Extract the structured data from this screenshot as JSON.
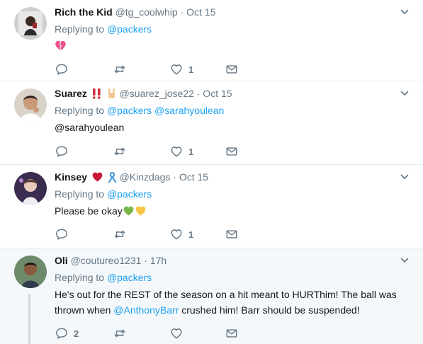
{
  "tweets": [
    {
      "fullname": "Rich the Kid",
      "meta": "@tg_coolwhip · Oct 15",
      "replying_label": "Replying to",
      "replying_to": "@packers",
      "text_emoji": "broken-heart-emoji",
      "reply_count": "",
      "retweet_count": "",
      "like_count": "1"
    },
    {
      "fullname": "Suarez",
      "name_emojis": [
        "double-exclamation-emoji",
        "rock-hand-emoji"
      ],
      "meta": "@suarez_jose22 · Oct 15",
      "replying_label": "Replying to",
      "replying_to": "@packers @sarahyoulean",
      "text": "@sarahyoulean",
      "reply_count": "",
      "retweet_count": "",
      "like_count": "1"
    },
    {
      "fullname": "Kinsey",
      "name_emojis": [
        "red-heart-emoji",
        "awareness-ribbon-emoji"
      ],
      "meta": "@Kinzdags · Oct 15",
      "replying_label": "Replying to",
      "replying_to": "@packers",
      "text": "Please be okay",
      "text_emojis": [
        "green-heart-emoji",
        "yellow-heart-emoji"
      ],
      "reply_count": "",
      "retweet_count": "",
      "like_count": "1"
    },
    {
      "fullname": "Oli",
      "meta": "@coutureo1231 · 17h",
      "replying_label": "Replying to",
      "replying_to": "@packers",
      "text_line1": "He's out for the REST of the season on a hit meant to HURThim! The ball was",
      "text_line2_pre": "thrown when ",
      "text_line2_mention": "@AnthonyBarr",
      "text_line2_post": " crushed him! Barr should be suspended!",
      "reply_count": "2",
      "retweet_count": "",
      "like_count": ""
    }
  ],
  "colors": {
    "link": "#1da1f2",
    "secondary": "#657786",
    "highlight_bg": "#f5f8fa",
    "divider": "#e6ecf0"
  }
}
